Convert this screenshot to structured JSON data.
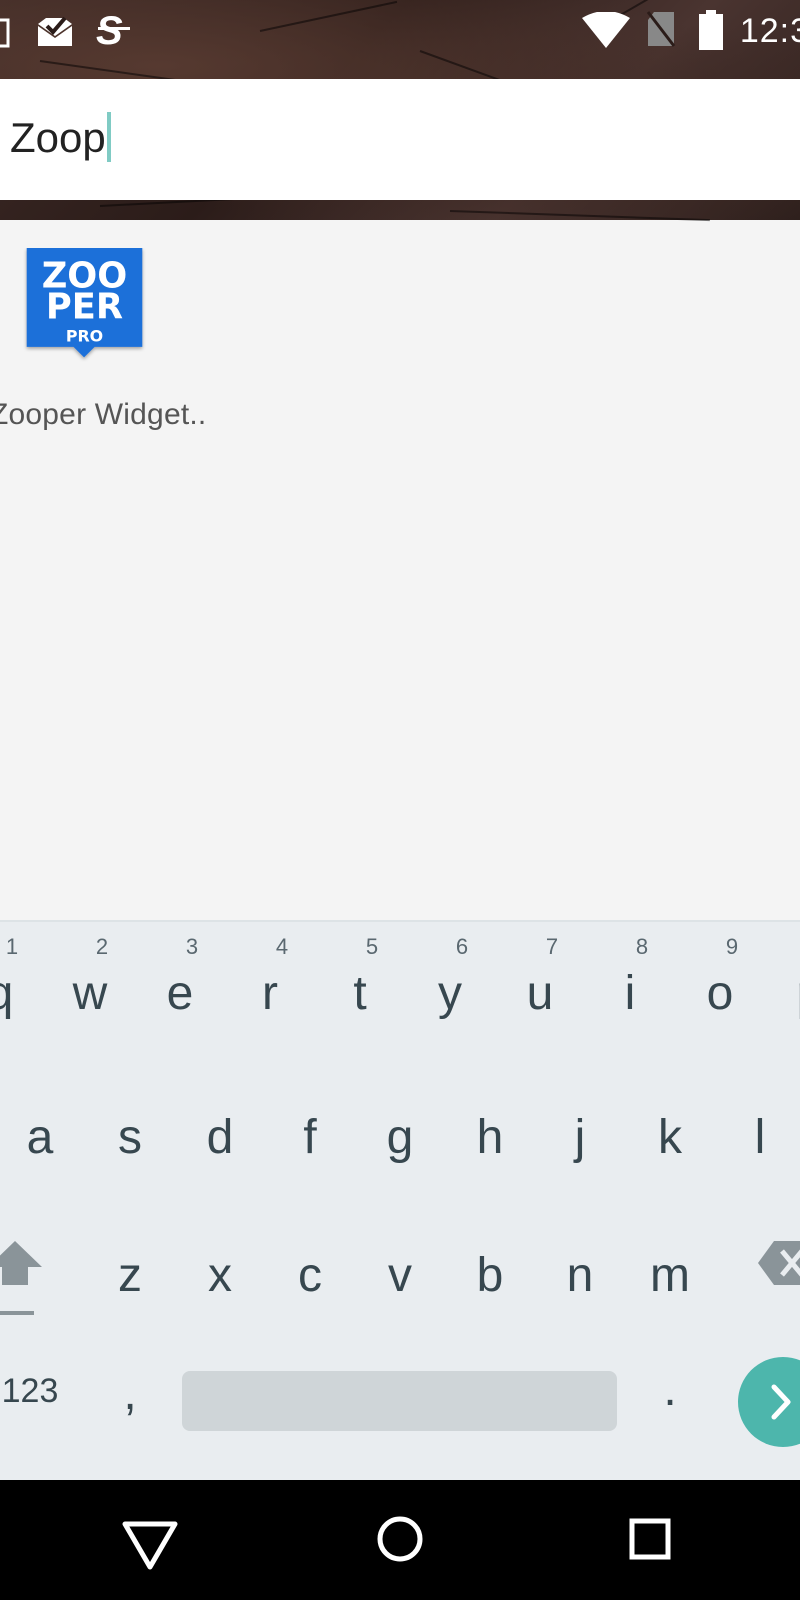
{
  "status_bar": {
    "clock": "12:3",
    "icons": [
      "gallery-icon",
      "mail-check-icon",
      "s-app-icon",
      "wifi-icon",
      "no-sim-icon",
      "battery-icon"
    ]
  },
  "search": {
    "query": "Zoop"
  },
  "results": [
    {
      "label": "Zooper Widget..",
      "icon": "zooper-pro-icon",
      "icon_text": [
        "ZOO",
        "PER",
        "PRO"
      ],
      "color": "#1e6fd9"
    }
  ],
  "keyboard": {
    "row1": [
      {
        "ch": "q",
        "num": "1"
      },
      {
        "ch": "w",
        "num": "2"
      },
      {
        "ch": "e",
        "num": "3"
      },
      {
        "ch": "r",
        "num": "4"
      },
      {
        "ch": "t",
        "num": "5"
      },
      {
        "ch": "y",
        "num": "6"
      },
      {
        "ch": "u",
        "num": "7"
      },
      {
        "ch": "i",
        "num": "8"
      },
      {
        "ch": "o",
        "num": "9"
      },
      {
        "ch": "p",
        "num": ""
      }
    ],
    "row2": [
      "a",
      "s",
      "d",
      "f",
      "g",
      "h",
      "j",
      "k",
      "l"
    ],
    "row3": [
      "z",
      "x",
      "c",
      "v",
      "b",
      "n",
      "m"
    ],
    "symbols_label": "123",
    "comma": ",",
    "period": ".",
    "accent_color": "#4db6ac"
  },
  "nav_bar": {
    "icons": [
      "back-triangle-icon",
      "home-circle-icon",
      "recents-square-icon"
    ]
  }
}
